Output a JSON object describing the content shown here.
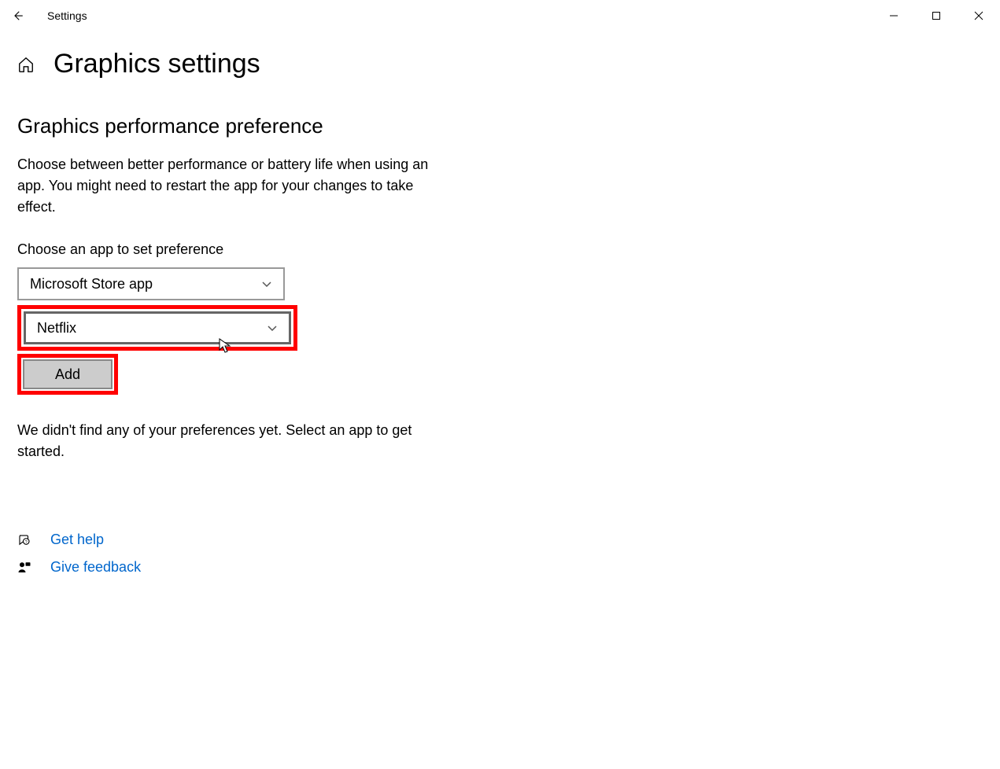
{
  "titlebar": {
    "title": "Settings"
  },
  "page": {
    "title": "Graphics settings"
  },
  "section": {
    "title": "Graphics performance preference",
    "description": "Choose between better performance or battery life when using an app. You might need to restart the app for your changes to take effect.",
    "choose_label": "Choose an app to set preference"
  },
  "dropdowns": {
    "app_type": "Microsoft Store app",
    "app_name": "Netflix"
  },
  "buttons": {
    "add": "Add"
  },
  "status": "We didn't find any of your preferences yet. Select an app to get started.",
  "links": {
    "get_help": "Get help",
    "give_feedback": "Give feedback"
  }
}
